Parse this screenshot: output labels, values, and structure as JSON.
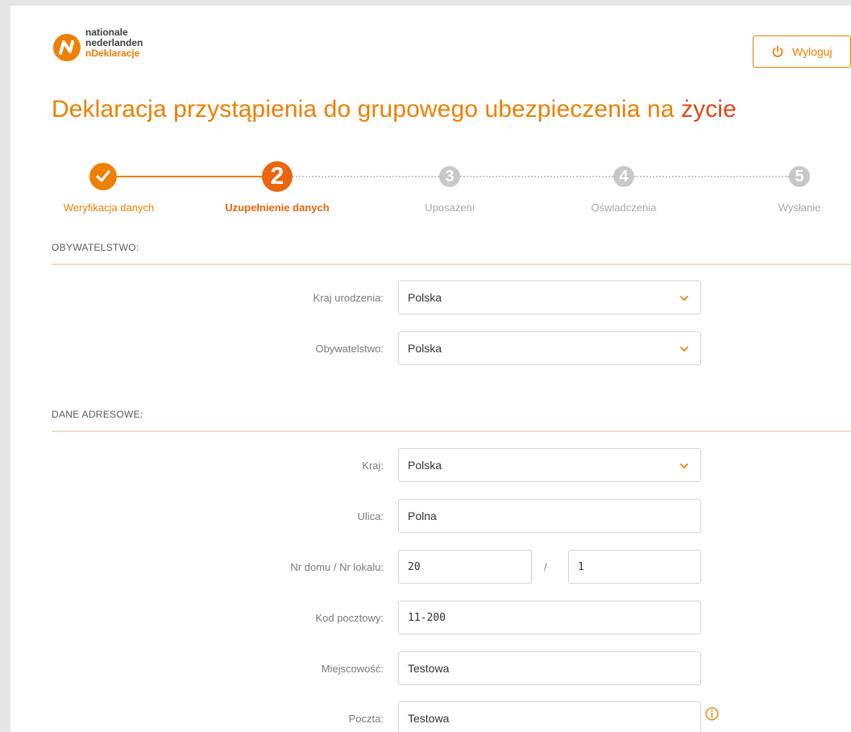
{
  "header": {
    "logo_lines": [
      "nationale",
      "nederlanden",
      "nDeklaracje"
    ],
    "logout_label": "Wyloguj"
  },
  "title": {
    "main": "Deklaracja przystąpienia do grupowego ubezpieczenia na ",
    "accent": "życie"
  },
  "stepper": {
    "steps": [
      {
        "number": "1",
        "label": "Weryfikacja danych",
        "state": "done"
      },
      {
        "number": "2",
        "label": "Uzupełnienie danych",
        "state": "active"
      },
      {
        "number": "3",
        "label": "Uposażeni",
        "state": "todo"
      },
      {
        "number": "4",
        "label": "Oświadczenia",
        "state": "todo"
      },
      {
        "number": "5",
        "label": "Wysłanie",
        "state": "todo"
      }
    ]
  },
  "citizenship": {
    "section_title": "OBYWATELSTWO:",
    "birth_country": {
      "label": "Kraj urodzenia:",
      "value": "Polska"
    },
    "citizenship": {
      "label": "Obywatelstwo:",
      "value": "Polska"
    }
  },
  "address": {
    "section_title": "DANE ADRESOWE:",
    "country": {
      "label": "Kraj:",
      "value": "Polska"
    },
    "street": {
      "label": "Ulica:",
      "value": "Polna"
    },
    "house": {
      "label": "Nr domu / Nr lokalu:",
      "house_value": "20",
      "separator": "/",
      "flat_value": "1"
    },
    "postal_code": {
      "label": "Kod pocztowy:",
      "value": "11-200"
    },
    "city": {
      "label": "Miejscowość:",
      "value": "Testowa"
    },
    "post_office": {
      "label": "Poczta:",
      "value": "Testowa"
    }
  },
  "colors": {
    "accent": "#ee7f00",
    "accent_dark": "#ea650d",
    "title_accent": "#e64415",
    "inactive": "#c8c8c8"
  }
}
